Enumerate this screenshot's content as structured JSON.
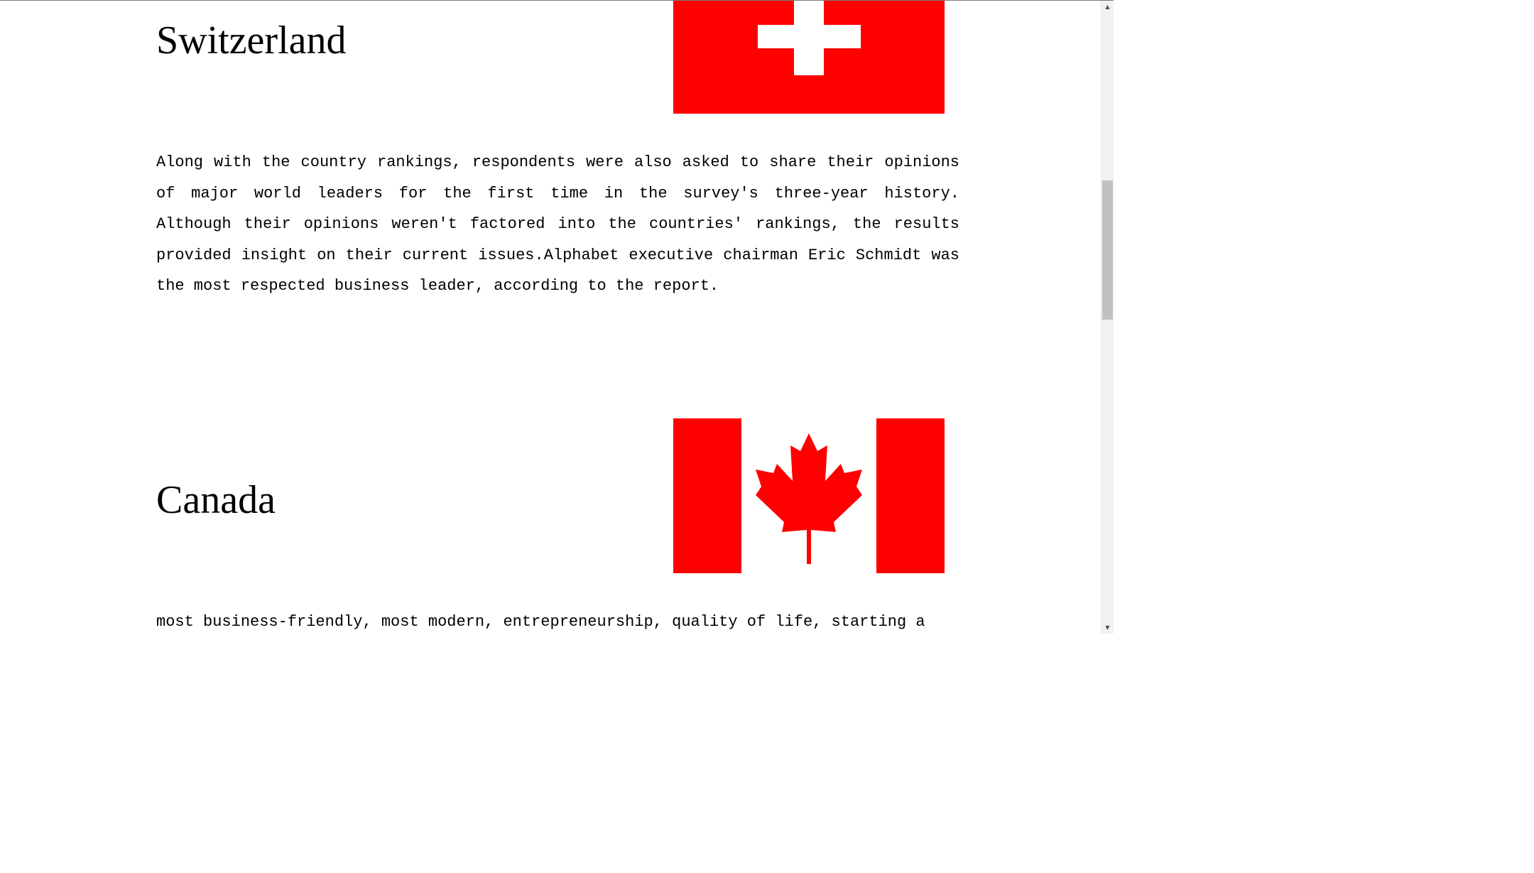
{
  "sections": [
    {
      "title": "Switzerland",
      "flag_icon": "switzerland-flag-icon",
      "paragraph": "Along with the country rankings, respondents were also asked to share their opinions of major world leaders for the first time in the survey's three-year history. Although their opinions weren't factored into the countries' rankings, the results provided insight on their current issues.Alphabet executive chairman Eric Schmidt was the most respected business leader, according to the report."
    },
    {
      "title": "Canada",
      "flag_icon": "canada-flag-icon",
      "paragraph": "most business-friendly, most modern, entrepreneurship, quality of life, starting a"
    }
  ],
  "colors": {
    "flag_red": "#ff0000",
    "flag_white": "#ffffff",
    "text": "#000000",
    "scrollbar_track": "#f1f1f1",
    "scrollbar_thumb": "#c1c1c1"
  },
  "scrollbar": {
    "position_fraction": 0.29,
    "up_arrow_icon": "scroll-up-arrow-icon",
    "down_arrow_icon": "scroll-down-arrow-icon"
  }
}
